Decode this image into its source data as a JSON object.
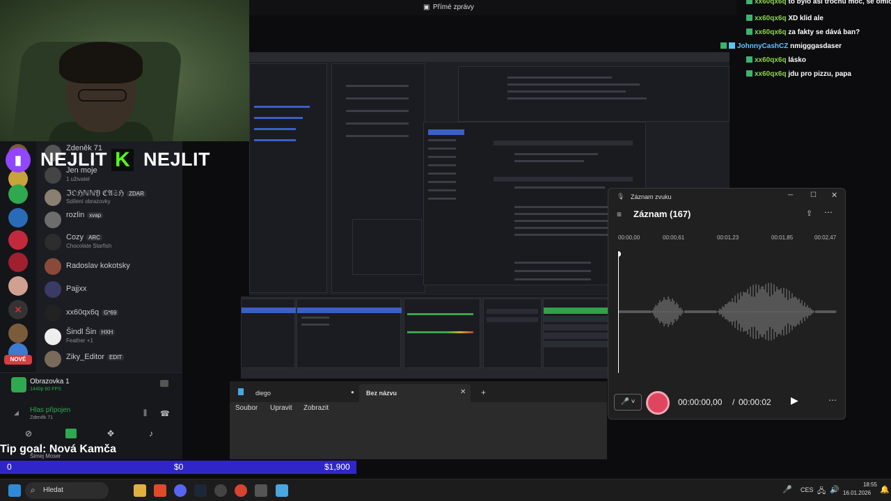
{
  "top_bar": {
    "direct_messages": "Přímé zprávy"
  },
  "overlay": {
    "left_name": "NEJLIT",
    "right_name": "NEJLIT"
  },
  "chat": [
    {
      "user": "xx60qx6q",
      "message": "to bylo asi trochu moc, se omlo"
    },
    {
      "user": "xx60qx6q",
      "message": "XD klid ale"
    },
    {
      "user": "xx60qx6q",
      "message": "za fakty se dává ban?"
    },
    {
      "user": "JohnnyCashCZ",
      "message": "nmigggasdaser"
    },
    {
      "user": "xx60qx6q",
      "message": "lásko"
    },
    {
      "user": "xx60qx6q",
      "message": "jdu pro pizzu, papa"
    }
  ],
  "discord": {
    "members": [
      {
        "name": "Zdeněk 71",
        "sub": ""
      },
      {
        "name": "Jen moje",
        "sub": "1 uživatel"
      },
      {
        "name": "ℑ𝔒ℌℕℕ𝔜 ℭ𝔄𝔖ℌ",
        "tag": "ZDAR",
        "sub": "Sdílení obrazovky"
      },
      {
        "name": "rozlin",
        "tag": "xvap",
        "sub": ""
      },
      {
        "name": "Cozy",
        "tag": "ARC",
        "sub": "Chocolate Starfish"
      },
      {
        "name": "Radoslav kokotsky",
        "tag": "",
        "sub": ""
      },
      {
        "name": "Pajjxx",
        "tag": "",
        "sub": ""
      },
      {
        "name": "xx60qx6q",
        "tag": "G*69",
        "sub": ""
      },
      {
        "name": "Šindl Šin",
        "tag": "HXH",
        "sub": "Feather +1"
      },
      {
        "name": "Ziky_Editor",
        "tag": "EDIT",
        "sub": ""
      }
    ],
    "new_badge": "NOVÉ",
    "stream": {
      "title": "Obrazovka 1",
      "quality": "1440p 60 FPS"
    },
    "voice": {
      "status": "Hlas připojen",
      "channel": "Zdeněk 71"
    },
    "user_peek": "Šimej Moser"
  },
  "tip_goal": {
    "label": "Tip goal: Nová Kamča",
    "start": "0",
    "current": "$0",
    "target": "$1,900"
  },
  "recorder": {
    "window_title": "Záznam zvuku",
    "recording_title": "Záznam (167)",
    "ticks": [
      "00:00,00",
      "00:00,61",
      "00:01,23",
      "00:01,85",
      "00:02,47"
    ],
    "elapsed": "00:00:00,00",
    "separator": "/",
    "total": "00:00:02"
  },
  "notepad": {
    "tab1": "diego",
    "tab2": "Bez názvu",
    "menu": [
      "Soubor",
      "Upravit",
      "Zobrazit"
    ]
  },
  "taskbar": {
    "search_placeholder": "Hledat",
    "language": "CES",
    "time": "18:55",
    "date": "16.01.2026"
  }
}
